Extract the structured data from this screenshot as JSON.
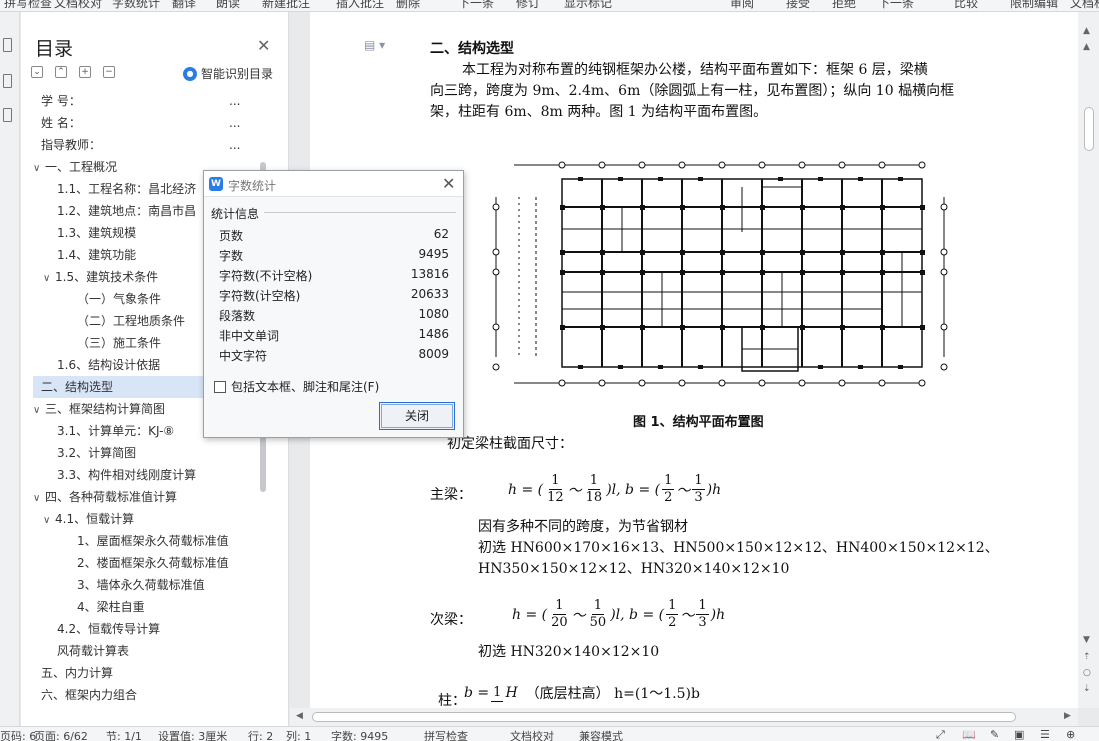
{
  "toolbar": {
    "items": [
      {
        "label": "拼写检查"
      },
      {
        "label": "文档校对"
      },
      {
        "label": "字数统计"
      },
      {
        "label": "翻译"
      },
      {
        "label": "朗读"
      },
      {
        "label": "新建批注"
      },
      {
        "label": "插入批注"
      },
      {
        "label": "删除"
      },
      {
        "label": "下一条"
      },
      {
        "label": "修订"
      },
      {
        "label": "显示标记"
      },
      {
        "label": "审阅"
      },
      {
        "label": "接受"
      },
      {
        "label": "拒绝"
      },
      {
        "label": "下一条"
      },
      {
        "label": "比较"
      },
      {
        "label": "限制编辑"
      },
      {
        "label": "文档权限"
      }
    ]
  },
  "toc": {
    "title": "目录",
    "smart_label": "智能识别目录",
    "items": [
      {
        "label": "学    号：",
        "level": 0,
        "dots": "..."
      },
      {
        "label": "姓    名：",
        "level": 0,
        "dots": "..."
      },
      {
        "label": "指导教师：",
        "level": 0,
        "dots": "..."
      },
      {
        "label": "一、工程概况",
        "level": 0,
        "chev": "∨"
      },
      {
        "label": "1.1、工程名称：昌北经济",
        "level": 1
      },
      {
        "label": "1.2、建筑地点：南昌市昌",
        "level": 1
      },
      {
        "label": "1.3、建筑规模",
        "level": 1
      },
      {
        "label": "1.4、建筑功能",
        "level": 1
      },
      {
        "label": "1.5、建筑技术条件",
        "level": 1,
        "chev": "∨"
      },
      {
        "label": "（一）气象条件",
        "level": 2
      },
      {
        "label": "（二）工程地质条件",
        "level": 2
      },
      {
        "label": "（三）施工条件",
        "level": 2
      },
      {
        "label": "1.6、结构设计依据",
        "level": 1
      },
      {
        "label": "二、结构选型",
        "level": 0,
        "active": true
      },
      {
        "label": "三、框架结构计算简图",
        "level": 0,
        "chev": "∨"
      },
      {
        "label": "3.1、计算单元：KJ-⑧",
        "level": 1
      },
      {
        "label": "3.2、计算简图",
        "level": 1
      },
      {
        "label": "3.3、构件相对线刚度计算",
        "level": 1
      },
      {
        "label": "四、各种荷载标准值计算",
        "level": 0,
        "chev": "∨"
      },
      {
        "label": "4.1、恒载计算",
        "level": 1,
        "chev": "∨"
      },
      {
        "label": "1、屋面框架永久荷载标准值",
        "level": 2
      },
      {
        "label": "2、楼面框架永久荷载标准值",
        "level": 2
      },
      {
        "label": "3、墙体永久荷载标准值",
        "level": 2
      },
      {
        "label": "4、梁柱自重",
        "level": 2
      },
      {
        "label": "4.2、恒载传导计算",
        "level": 1
      },
      {
        "label": "风荷载计算表",
        "level": 1
      },
      {
        "label": "五、内力计算",
        "level": 0
      },
      {
        "label": "六、框架内力组合",
        "level": 0
      }
    ]
  },
  "document": {
    "heading": "二、结构选型",
    "para_lines": [
      "本工程为对称布置的纯钢框架办公楼，结构平面布置如下：框架 6 层，梁横",
      "向三跨，跨度为 9m、2.4m、6m（除圆弧上有一柱，见布置图）；纵向 10 榀横向框",
      "架，柱距有 6m、8m 两种。图 1 为结构平面布置图。"
    ],
    "figure_caption": "图 1、结构平面布置图",
    "beam_intro": "初定梁柱截面尺寸：",
    "main_beam_label": "主梁：",
    "main_beam_formula": {
      "prefix": "h = (",
      "f1": [
        "1",
        "12"
      ],
      "tilde": "～",
      "f2": [
        "1",
        "18"
      ],
      "mid": ")l, b = (",
      "f3": [
        "1",
        "2"
      ],
      "f4": [
        "1",
        "3"
      ],
      "suffix": ")h"
    },
    "main_beam_note": "因有多种不同的跨度，为节省钢材",
    "main_beam_select_1": "初选 HN600×170×16×13、HN500×150×12×12、HN400×150×12×12、",
    "main_beam_select_2": "HN350×150×12×12、HN320×140×12×10",
    "sec_beam_label": "次梁：",
    "sec_beam_formula": {
      "prefix": "h = (",
      "f1": [
        "1",
        "20"
      ],
      "tilde": "～",
      "f2": [
        "1",
        "50"
      ],
      "mid": ")l, b = (",
      "f3": [
        "1",
        "2"
      ],
      "f4": [
        "1",
        "3"
      ],
      "suffix": ")h"
    },
    "sec_beam_select": "初选 HN320×140×12×10",
    "column_label": "柱：",
    "column_formula": {
      "prefix": "b = ",
      "f1": [
        "1",
        ""
      ],
      "var": "H",
      "note": "（底层柱高）    h=(1～1.5)b"
    }
  },
  "dialog": {
    "title": "字数统计",
    "section": "统计信息",
    "stats": [
      {
        "label": "页数",
        "value": "62"
      },
      {
        "label": "字数",
        "value": "9495"
      },
      {
        "label": "字符数(不计空格)",
        "value": "13816"
      },
      {
        "label": "字符数(计空格)",
        "value": "20633"
      },
      {
        "label": "段落数",
        "value": "1080"
      },
      {
        "label": "非中文单词",
        "value": "1486"
      },
      {
        "label": "中文字符",
        "value": "8009"
      }
    ],
    "checkbox_label": "包括文本框、脚注和尾注(F)",
    "checkbox_checked": false,
    "close_button": "关闭"
  },
  "statusbar": {
    "items": [
      {
        "label": "页码: 6"
      },
      {
        "label": "页面: 6/62"
      },
      {
        "label": "节: 1/1"
      },
      {
        "label": "设置值: 3厘米"
      },
      {
        "label": "行: 2"
      },
      {
        "label": "列: 1"
      },
      {
        "label": "字数: 9495"
      },
      {
        "label": "拼写检查"
      },
      {
        "label": "文档校对"
      },
      {
        "label": "兼容模式"
      }
    ]
  }
}
